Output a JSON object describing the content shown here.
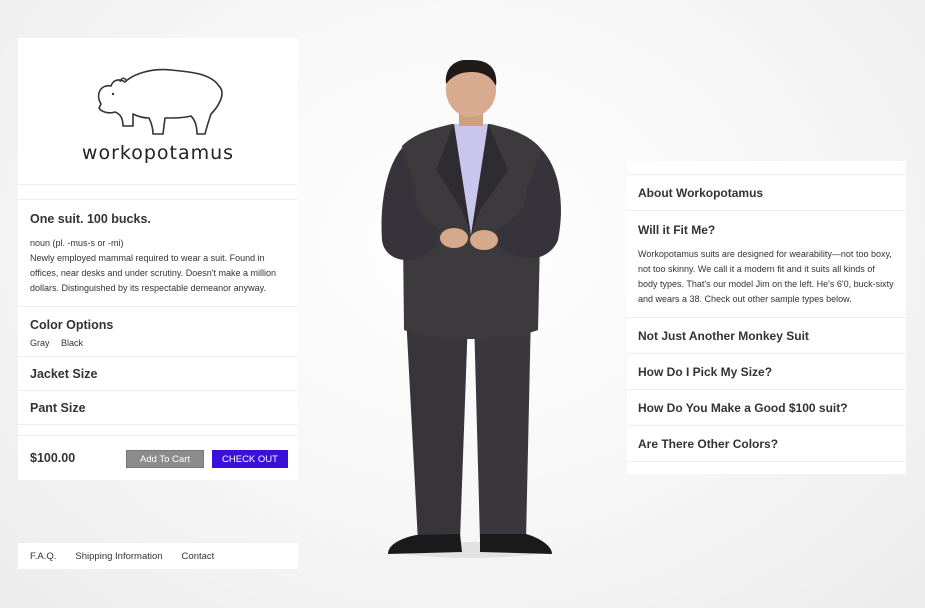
{
  "brand": {
    "name": "workopotamus",
    "logo_icon": "hippo-icon"
  },
  "product": {
    "headline": "One suit. 100 bucks.",
    "definition_line": "noun (pl. -mus-s or -mi)",
    "description": "Newly employed mammal required to wear a suit. Found in offices, near desks and under scrutiny. Doesn't make a million dollars. Distinguished by its respectable demeanor anyway.",
    "color_options_label": "Color Options",
    "colors": [
      "Gray",
      "Black"
    ],
    "jacket_size_label": "Jacket Size",
    "pant_size_label": "Pant Size",
    "price": "$100.00",
    "add_to_cart_label": "Add To Cart",
    "checkout_label": "CHECK OUT"
  },
  "footer": {
    "links": [
      "F.A.Q.",
      "Shipping Information",
      "Contact"
    ]
  },
  "faq": {
    "items": [
      {
        "title": "About Workopotamus"
      },
      {
        "title": "Will it Fit Me?",
        "body": "Workopotamus suits are designed for wearability—not too boxy, not too skinny. We call it a modern fit and it suits all kinds of body types. That's our model Jim on the left. He's 6'0, buck-sixty and wears a 38. Check out other sample types below."
      },
      {
        "title": "Not Just Another Monkey Suit"
      },
      {
        "title": "How Do I Pick My Size?"
      },
      {
        "title": "How Do You Make a Good $100 suit?"
      },
      {
        "title": "Are There Other Colors?"
      }
    ]
  },
  "colors": {
    "checkout": "#3a10d8",
    "add_to_cart": "#8c8c8c",
    "suit": "#3b3839",
    "shirt": "#c9c6ee"
  }
}
